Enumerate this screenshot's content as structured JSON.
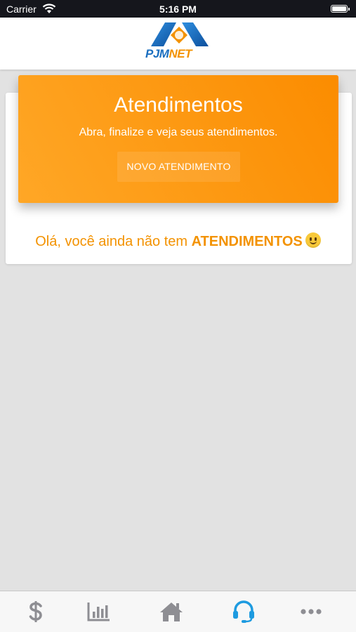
{
  "status_bar": {
    "carrier": "Carrier",
    "time": "5:16 PM",
    "battery_level": 1.0
  },
  "header": {
    "logo_text_1": "PJM",
    "logo_text_2": "NET"
  },
  "hero": {
    "title": "Atendimentos",
    "subtitle": "Abra, finalize e veja seus atendimentos.",
    "button_label": "NOVO ATENDIMENTO"
  },
  "empty_state": {
    "prefix": "Olá, você ainda não tem ",
    "highlight": "ATENDIMENTOS",
    "emoji": "smiley-icon"
  },
  "tabs": [
    {
      "icon": "dollar-icon",
      "active": false
    },
    {
      "icon": "bar-chart-icon",
      "active": false
    },
    {
      "icon": "home-icon",
      "active": false
    },
    {
      "icon": "headset-icon",
      "active": true
    },
    {
      "icon": "more-icon",
      "active": false
    }
  ],
  "colors": {
    "accent": "#f39200",
    "active_tab": "#1e9be0",
    "inactive_tab": "#8e8e93",
    "hero_gradient_start": "#ffa726",
    "hero_gradient_end": "#fb8c00"
  }
}
